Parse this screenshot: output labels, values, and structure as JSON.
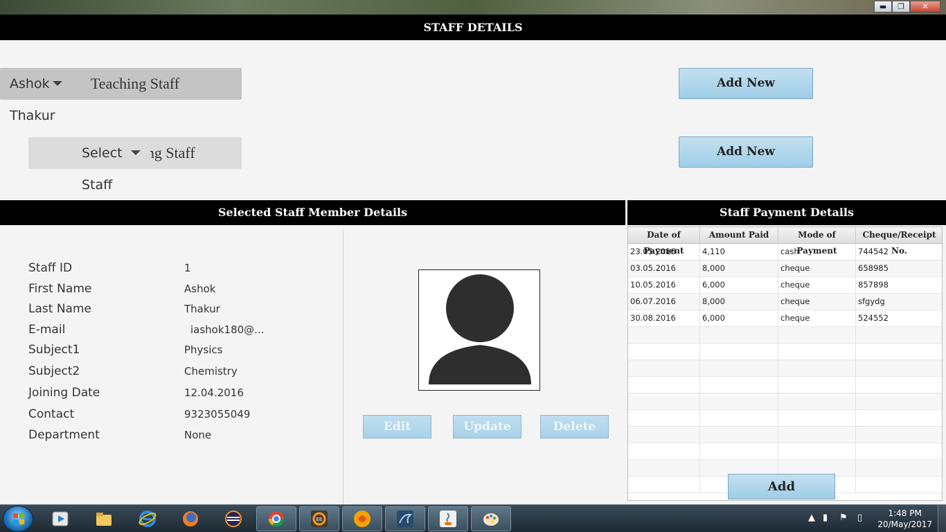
{
  "window": {
    "minimize": "▬",
    "maximize": "❐",
    "close": "✕"
  },
  "header": {
    "title": "STAFF DETAILS"
  },
  "staff_type": {
    "teaching": "Teaching Staff",
    "non_teaching": "Non-Teaching Staff"
  },
  "selectors": {
    "teaching_selected": "Ashok Thakur",
    "non_teaching_placeholder": "Select Staff"
  },
  "buttons": {
    "add_new_1": "Add New",
    "add_new_2": "Add New",
    "edit": "Edit",
    "update": "Update",
    "delete": "Delete",
    "add": "Add"
  },
  "member": {
    "title": "Selected Staff Member Details",
    "fields": [
      {
        "label": "Staff ID",
        "value": "1"
      },
      {
        "label": "First Name",
        "value": "Ashok"
      },
      {
        "label": "Last Name",
        "value": "Thakur"
      },
      {
        "label": "E-mail",
        "value": "iashok180@..."
      },
      {
        "label": "Subject1",
        "value": "Physics"
      },
      {
        "label": "Subject2",
        "value": "Chemistry"
      },
      {
        "label": "Joining Date",
        "value": "12.04.2016"
      },
      {
        "label": "Contact",
        "value": "9323055049"
      },
      {
        "label": "Department",
        "value": "None"
      }
    ]
  },
  "payments": {
    "title": "Staff Payment Details",
    "columns": [
      "Date of Payment",
      "Amount Paid",
      "Mode of Payment",
      "Cheque/Receipt No."
    ],
    "rows": [
      [
        "23.05.2016",
        "4,110",
        "cash",
        "744542"
      ],
      [
        "03.05.2016",
        "8,000",
        "cheque",
        "658985"
      ],
      [
        "10.05.2016",
        "6,000",
        "cheque",
        "857898"
      ],
      [
        "06.07.2016",
        "8,000",
        "cheque",
        "sfgydg"
      ],
      [
        "30.08.2016",
        "6,000",
        "cheque",
        "524552"
      ]
    ]
  },
  "taskbar": {
    "apps": [
      "media-player-icon",
      "file-explorer-icon",
      "internet-explorer-icon",
      "firefox-icon",
      "eclipse-icon",
      "chrome-icon",
      "java-ee-ide-icon",
      "swirl-app-icon",
      "mysql-workbench-icon",
      "java-app-icon",
      "paint-icon"
    ],
    "clock_time": "1:48 PM",
    "clock_date": "20/May/2017"
  },
  "colors": {
    "header_bg": "#000000",
    "button_blue": "#9ecde6",
    "panel_bg": "#f4f4f4"
  }
}
